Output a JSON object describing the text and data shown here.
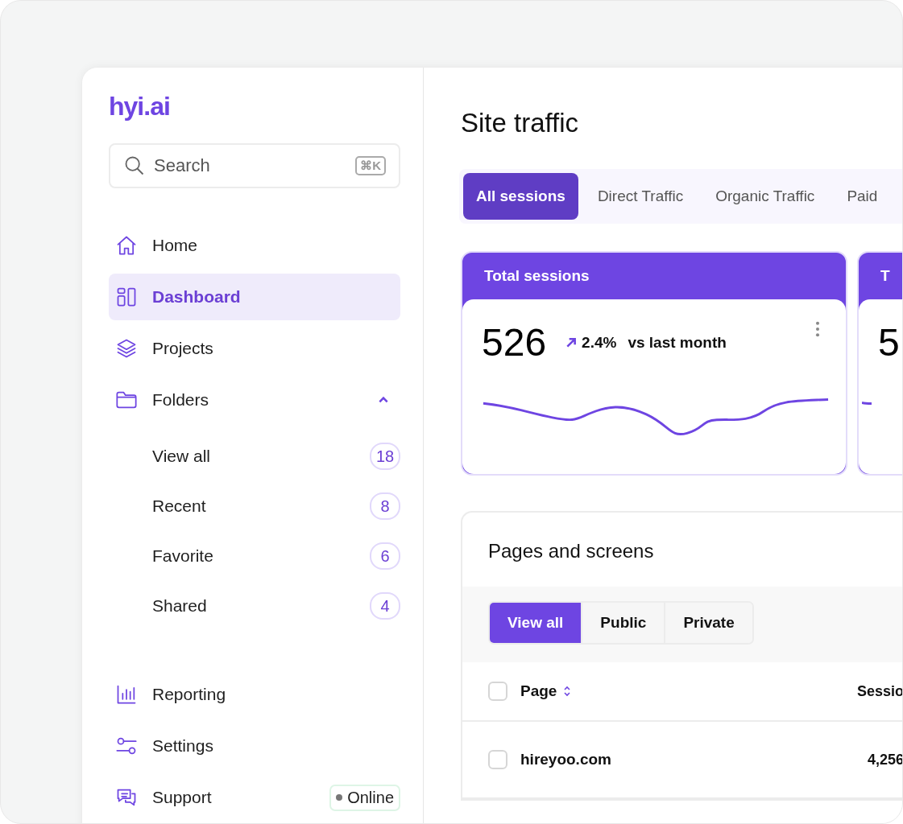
{
  "logo": "hyi.ai",
  "search": {
    "placeholder": "Search",
    "shortcut": "⌘K"
  },
  "sidebar": {
    "items": [
      {
        "kind": "home",
        "label": "Home",
        "selected": false
      },
      {
        "kind": "dashboard",
        "label": "Dashboard",
        "selected": true
      },
      {
        "kind": "projects",
        "label": "Projects",
        "selected": false
      },
      {
        "kind": "folders",
        "label": "Folders",
        "selected": false,
        "expanded": true,
        "children": [
          {
            "label": "View all",
            "count": "18",
            "selected": false
          },
          {
            "label": "Recent",
            "count": "8",
            "selected": false
          },
          {
            "label": "Favorite",
            "count": "6",
            "selected": false
          },
          {
            "label": "Shared",
            "count": "4",
            "selected": false
          }
        ]
      },
      {
        "kind": "reporting",
        "label": "Reporting",
        "selected": false
      },
      {
        "kind": "settings",
        "label": "Settings",
        "selected": false
      },
      {
        "kind": "support",
        "label": "Support",
        "selected": false,
        "status": "Online"
      }
    ]
  },
  "main": {
    "title": "Site traffic",
    "tabs": [
      {
        "label": "All sessions",
        "selected": true
      },
      {
        "label": "Direct Traffic",
        "selected": false
      },
      {
        "label": "Organic Traffic",
        "selected": false
      },
      {
        "label": "Paid",
        "selected": false
      }
    ],
    "cards": [
      {
        "title": "Total sessions",
        "value": "526",
        "change": "2.4%",
        "comparison": "vs last month"
      },
      {
        "title": "T",
        "value": "5"
      }
    ],
    "pages": {
      "title": "Pages and screens",
      "filters": [
        {
          "label": "View all",
          "selected": true
        },
        {
          "label": "Public",
          "selected": false
        },
        {
          "label": "Private",
          "selected": false
        }
      ],
      "all_checked": false,
      "columns": [
        "Page",
        "Sessio"
      ],
      "rows": [
        {
          "page": "hireyoo.com",
          "sessions": "4,256",
          "checked": false
        }
      ]
    }
  }
}
